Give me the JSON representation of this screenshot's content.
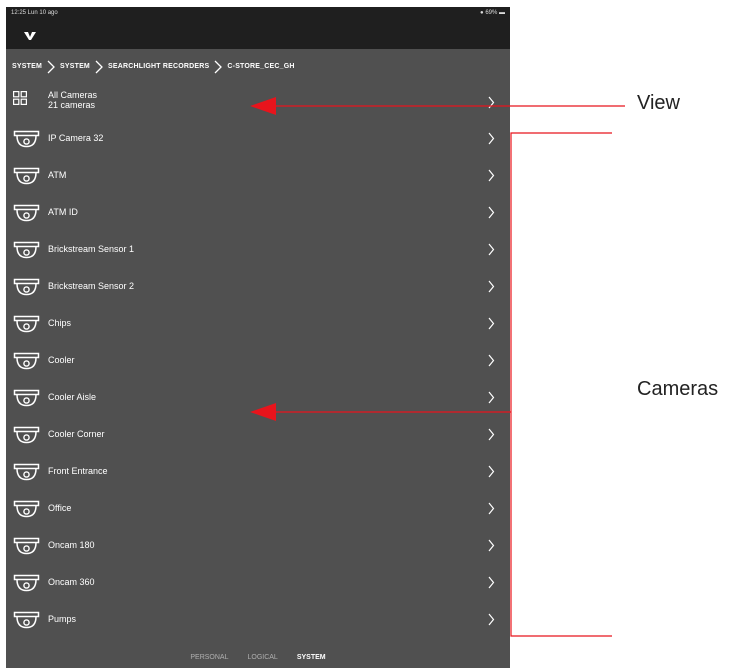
{
  "status_bar": {
    "time": "12:25  Lun 10 ago",
    "battery": "● 69% ▬"
  },
  "breadcrumb": [
    "SYSTEM",
    "SYSTEM",
    "SEARCHLIGHT RECORDERS",
    "C-STORE_CEC_GH"
  ],
  "view_row": {
    "title": "All Cameras",
    "subtitle": "21 cameras"
  },
  "cameras": [
    "IP Camera 32",
    "ATM",
    "ATM ID",
    "Brickstream Sensor 1",
    "Brickstream Sensor 2",
    "Chips",
    "Cooler",
    "Cooler Aisle",
    "Cooler Corner",
    "Front Entrance",
    "Office",
    "Oncam 180",
    "Oncam 360",
    "Pumps"
  ],
  "tabs": [
    "PERSONAL",
    "LOGICAL",
    "SYSTEM"
  ],
  "active_tab": "SYSTEM",
  "annotations": {
    "view": "View",
    "cameras": "Cameras"
  },
  "colors": {
    "panel": "#505050",
    "bar": "#1f1f1f",
    "arrow": "#e8141c",
    "text": "#ffffff"
  }
}
